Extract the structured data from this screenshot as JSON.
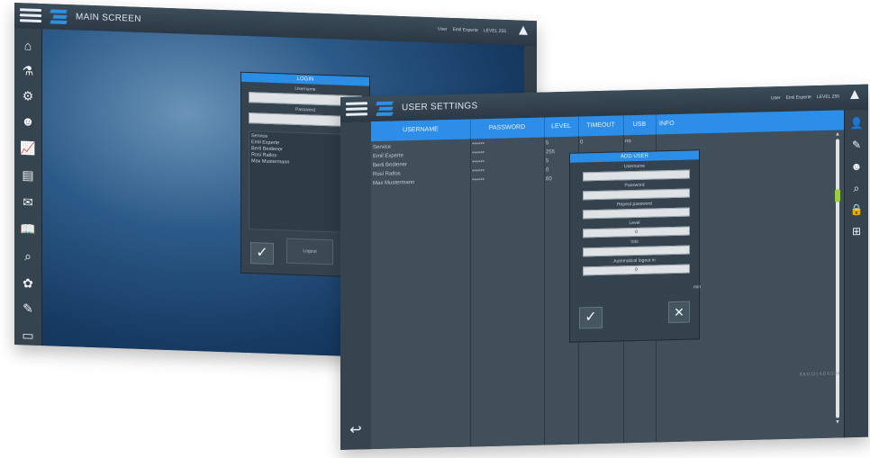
{
  "main_screen": {
    "title": "MAIN SCREEN",
    "user_label": "User",
    "user_name": "Emil Experte",
    "level": "LEVEL 255",
    "sidebar_icons": [
      "home-icon",
      "flask-icon",
      "gear-icon",
      "user-gear-icon",
      "chart-icon",
      "folders-icon",
      "mail-icon",
      "book-icon",
      "folder-search-icon",
      "gear-cycle-icon",
      "document-edit-icon",
      "screen-icon"
    ],
    "login": {
      "title": "LOGIN",
      "username_label": "Username",
      "password_label": "Password",
      "users": [
        "Service",
        "Emil Experte",
        "Berti Bediener",
        "Rosi Ratlos",
        "Max Mustermann"
      ],
      "logout_label": "Logout"
    }
  },
  "user_settings": {
    "title": "USER SETTINGS",
    "user_label": "User",
    "user_name": "Emil Experte",
    "level": "LEVEL 255",
    "columns": [
      "USERNAME",
      "PASSWORD",
      "LEVEL",
      "TIMEOUT",
      "USB",
      "INFO"
    ],
    "rows": [
      {
        "username": "Service",
        "password": "******",
        "level": "5",
        "timeout": "0",
        "usb": "no"
      },
      {
        "username": "Emil Experte",
        "password": "******",
        "level": "255",
        "timeout": "",
        "usb": ""
      },
      {
        "username": "Berti Bediener",
        "password": "******",
        "level": "5",
        "timeout": "",
        "usb": ""
      },
      {
        "username": "Rosi Ratlos",
        "password": "******",
        "level": "0",
        "timeout": "",
        "usb": ""
      },
      {
        "username": "Max Mustermann",
        "password": "******",
        "level": "60",
        "timeout": "",
        "usb": ""
      }
    ],
    "right_icons": [
      "add-user-icon",
      "edit-user-icon",
      "user-icon",
      "user-search-icon",
      "user-lock-icon",
      "usb-add-icon"
    ],
    "status_text": "9.6.0.12 | 4.0 4.3.04",
    "add_user": {
      "title": "ADD USER",
      "username_label": "Username",
      "password_label": "Password",
      "repeat_password_label": "Repeat password",
      "level_label": "Level",
      "level_value": "0",
      "info_label": "Info",
      "logout_label": "Automatical logout in",
      "logout_value": "0",
      "logout_unit": "min"
    }
  }
}
